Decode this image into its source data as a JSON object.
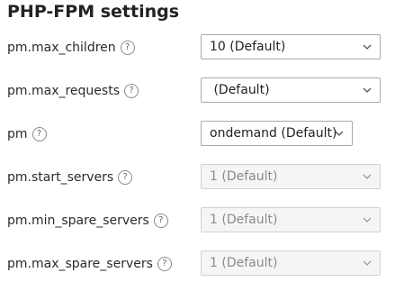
{
  "section": {
    "title": "PHP-FPM settings"
  },
  "help_glyph": "?",
  "fields": [
    {
      "label": "pm.max_children",
      "value": "10 (Default)",
      "disabled": false
    },
    {
      "label": "pm.max_requests",
      "value": " (Default)",
      "disabled": false
    },
    {
      "label": "pm",
      "value": "ondemand (Default)",
      "disabled": false
    },
    {
      "label": "pm.start_servers",
      "value": "1 (Default)",
      "disabled": true
    },
    {
      "label": "pm.min_spare_servers",
      "value": "1 (Default)",
      "disabled": true
    },
    {
      "label": "pm.max_spare_servers",
      "value": "1 (Default)",
      "disabled": true
    }
  ],
  "icons": {
    "help": "question-circle-icon",
    "dropdown": "chevron-down-icon"
  },
  "colors": {
    "text": "#222222",
    "border": "#a9a9a9",
    "disabled_bg": "#f5f5f5",
    "disabled_text": "#8a8a8a"
  }
}
